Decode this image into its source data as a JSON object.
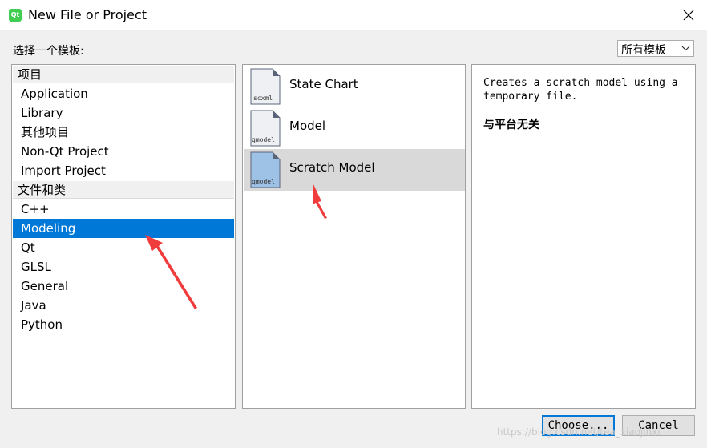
{
  "window": {
    "title": "New File or Project",
    "app_icon_text": "Qt"
  },
  "filter": {
    "label": "选择一个模板:",
    "selected": "所有模板"
  },
  "categories": {
    "groups": [
      {
        "header": "项目",
        "items": [
          "Application",
          "Library",
          "其他项目",
          "Non-Qt Project",
          "Import Project"
        ]
      },
      {
        "header": "文件和类",
        "items": [
          "C++",
          "Modeling",
          "Qt",
          "GLSL",
          "General",
          "Java",
          "Python"
        ]
      }
    ],
    "selected": "Modeling"
  },
  "templates": {
    "items": [
      {
        "label": "State Chart",
        "icon_text": "scxml"
      },
      {
        "label": "Model",
        "icon_text": "qmodel"
      },
      {
        "label": "Scratch Model",
        "icon_text": "qmodel"
      }
    ],
    "selected": "Scratch Model"
  },
  "description": {
    "text": "Creates a scratch model using a temporary file.",
    "platform": "与平台无关"
  },
  "buttons": {
    "choose": "Choose...",
    "cancel": "Cancel"
  },
  "watermark": "https://blog.csdn.net/tea_xiaojinxi",
  "colors": {
    "selection": "#0078d7",
    "annotation_arrow": "#f03c3c"
  }
}
